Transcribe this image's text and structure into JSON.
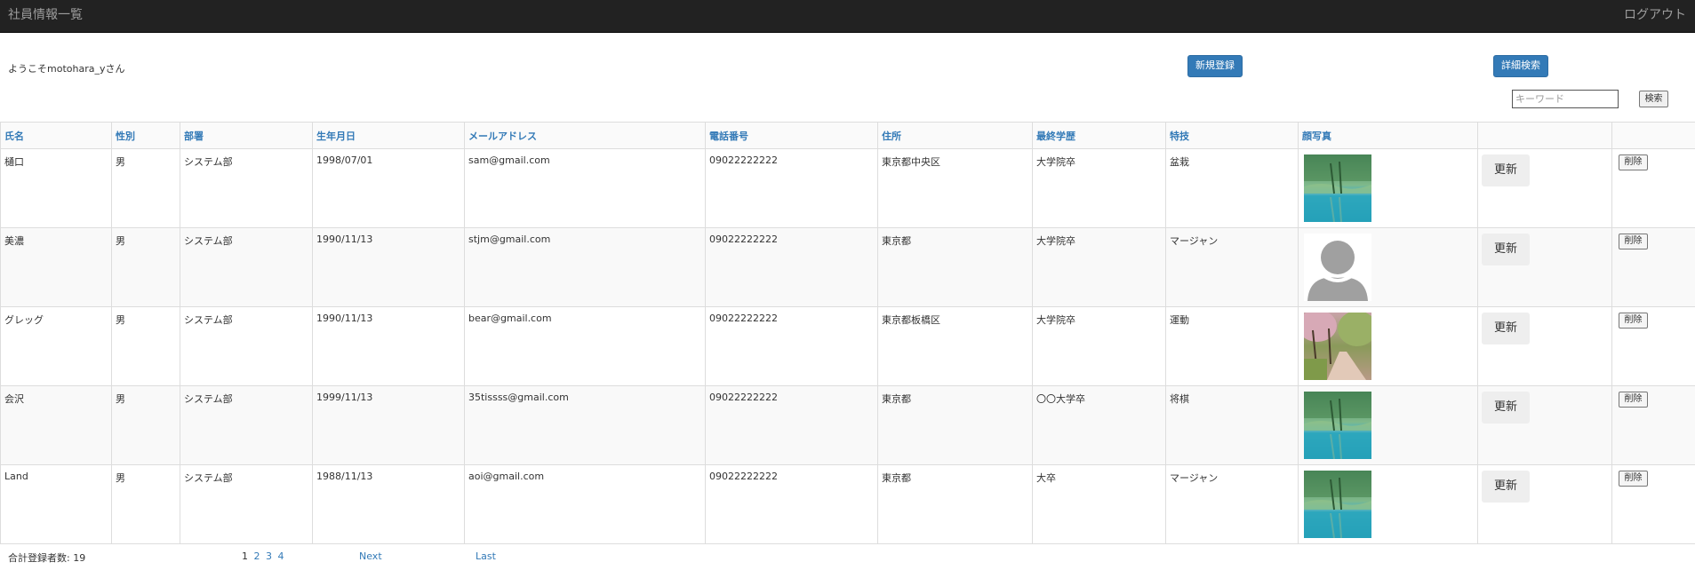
{
  "header": {
    "title": "社員情報一覧",
    "logout": "ログアウト"
  },
  "welcome": "ようこそmotohara_yさん",
  "buttons": {
    "new_register": "新規登録",
    "advanced_search": "詳細検索",
    "search": "検索"
  },
  "search": {
    "placeholder": "キーワード"
  },
  "table": {
    "headers": [
      "氏名",
      "性別",
      "部署",
      "生年月日",
      "メールアドレス",
      "電話番号",
      "住所",
      "最終学歴",
      "特技",
      "顔写真"
    ],
    "update_label": "更新",
    "delete_label": "削除",
    "rows": [
      {
        "name": "樋口",
        "gender": "男",
        "dept": "システム部",
        "birth": "1998/07/01",
        "email": "sam@gmail.com",
        "phone": "09022222222",
        "address": "東京都中央区",
        "education": "大学院卒",
        "skill": "盆栽",
        "photo": "lake-photo"
      },
      {
        "name": "美濃",
        "gender": "男",
        "dept": "システム部",
        "birth": "1990/11/13",
        "email": "stjm@gmail.com",
        "phone": "09022222222",
        "address": "東京都",
        "education": "大学院卒",
        "skill": "マージャン",
        "photo": "default-avatar"
      },
      {
        "name": "グレッグ",
        "gender": "男",
        "dept": "システム部",
        "birth": "1990/11/13",
        "email": "bear@gmail.com",
        "phone": "09022222222",
        "address": "東京都板橋区",
        "education": "大学院卒",
        "skill": "運動",
        "photo": "cherry-path-photo"
      },
      {
        "name": "会沢",
        "gender": "男",
        "dept": "システム部",
        "birth": "1999/11/13",
        "email": "35tissss@gmail.com",
        "phone": "09022222222",
        "address": "東京都",
        "education": "〇〇大学卒",
        "skill": "将棋",
        "photo": "lake-photo"
      },
      {
        "name": "Land",
        "gender": "男",
        "dept": "システム部",
        "birth": "1988/11/13",
        "email": "aoi@gmail.com",
        "phone": "09022222222",
        "address": "東京都",
        "education": "大卒",
        "skill": "マージャン",
        "photo": "lake-photo"
      }
    ]
  },
  "footer": {
    "total": "合計登録者数: 19",
    "current_page": "1",
    "pages": [
      "2",
      "3",
      "4"
    ],
    "next": "Next",
    "last": "Last"
  }
}
